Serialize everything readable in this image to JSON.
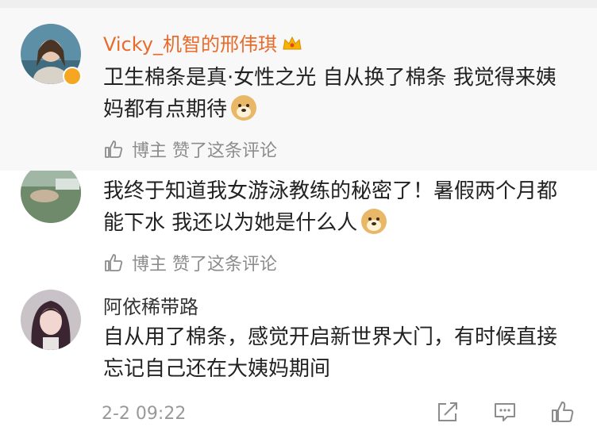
{
  "comments": [
    {
      "username": "Vicky_机智的邢伟琪",
      "text": "卫生棉条是真·女性之光 自从换了棉条 我觉得来姨妈都有点期待",
      "emoji": "doge-emoji",
      "like_note": "博主 赞了这条评论",
      "verified": true
    },
    {
      "username": "",
      "text": "我终于知道我女游泳教练的秘密了！暑假两个月都能下水 我还以为她是什么人",
      "emoji": "doge-emoji",
      "like_note": "博主 赞了这条评论"
    },
    {
      "username": "阿依稀带路",
      "text": "自从用了棉条，感觉开启新世界大门，有时候直接忘记自己还在大姨妈期间",
      "timestamp": "2-2 09:22"
    }
  ],
  "icons": {
    "like": "thumbs-up-icon",
    "share": "share-icon",
    "comment": "comment-icon",
    "crown": "crown-badge-icon"
  },
  "colors": {
    "username_accent": "#e86b2c",
    "muted": "#8c8c8c",
    "verified_badge": "#f5a623"
  }
}
